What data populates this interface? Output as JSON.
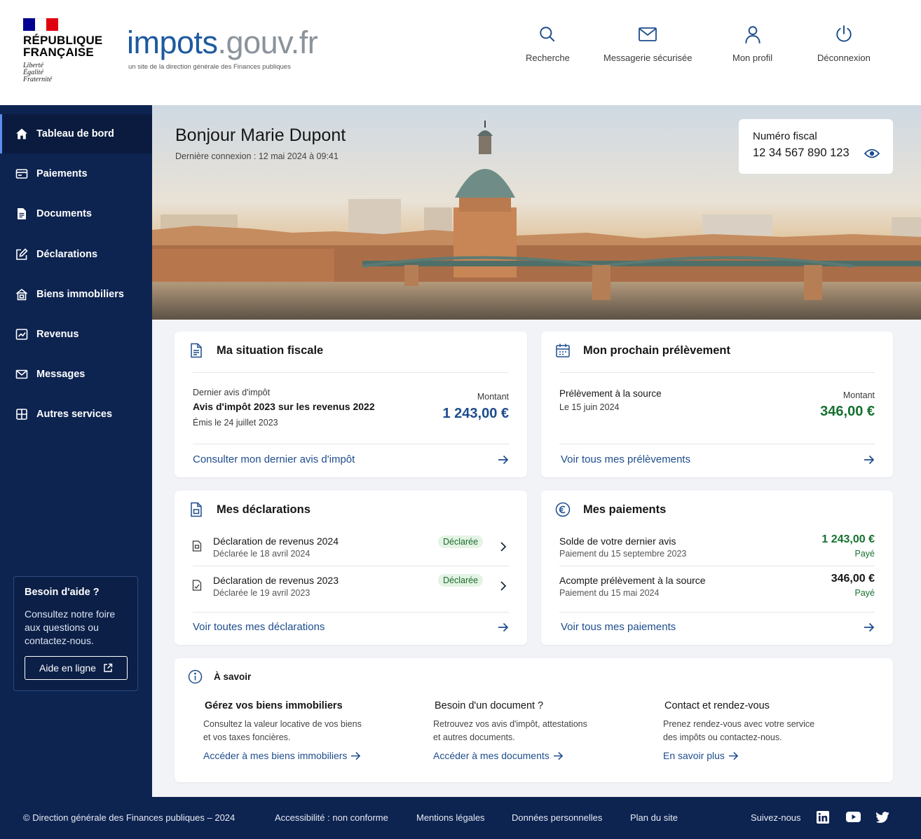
{
  "header": {
    "republic_name": "RÉPUBLIQUE\nFRANÇAISE",
    "motto": "Liberté\nÉgalité\nFraternité",
    "brand_part1": "impots",
    "brand_part2": ".gouv.fr",
    "brand_subtitle": "un site de la direction générale des Finances publiques",
    "nav": [
      {
        "label": "Recherche",
        "icon": "search-icon"
      },
      {
        "label": "Messagerie sécurisée",
        "icon": "mail-icon"
      },
      {
        "label": "Mon profil",
        "icon": "user-icon"
      },
      {
        "label": "Déconnexion",
        "icon": "power-icon"
      }
    ],
    "flag_colors": [
      "#000091",
      "#ffffff",
      "#e1000f"
    ]
  },
  "sidebar": {
    "items": [
      {
        "label": "Tableau de bord",
        "icon": "home-icon"
      },
      {
        "label": "Paiements",
        "icon": "payment-icon"
      },
      {
        "label": "Documents",
        "icon": "document-icon"
      },
      {
        "label": "Déclarations",
        "icon": "edit-icon"
      },
      {
        "label": "Biens immobiliers",
        "icon": "building-icon"
      },
      {
        "label": "Revenus",
        "icon": "income-icon"
      },
      {
        "label": "Messages",
        "icon": "mail-icon"
      },
      {
        "label": "Autres services",
        "icon": "grid-icon"
      }
    ],
    "help": {
      "title": "Besoin d'aide ?",
      "text": "Consultez notre foire aux questions ou contactez-nous.",
      "button": "Aide en ligne"
    }
  },
  "hero": {
    "greeting": "Bonjour Marie Dupont",
    "last_login": "Dernière connexion : 12 mai 2024 à 09:41",
    "fiscal_label": "Numéro fiscal",
    "fiscal_number": "12 34 567 890 123"
  },
  "situation": {
    "title": "Ma situation fiscale",
    "label": "Dernier avis d'impôt",
    "name": "Avis d'impôt 2023 sur les revenus 2022",
    "issued": "Émis le 24 juillet 2023",
    "amount_label": "Montant",
    "amount": "1 243,00 €",
    "link": "Consulter mon dernier avis d'impôt"
  },
  "prelevement": {
    "title": "Mon prochain prélèvement",
    "label": "Prélèvement à la source",
    "date": "Le 15 juin 2024",
    "amount_label": "Montant",
    "amount": "346,00 €",
    "link": "Voir tous mes prélèvements"
  },
  "declarations": {
    "title": "Mes déclarations",
    "rows": [
      {
        "title": "Déclaration de revenus 2024",
        "sub": "Déclarée le 18 avril 2024",
        "status": "Déclarée"
      },
      {
        "title": "Déclaration de revenus 2023",
        "sub": "Déclarée le 19 avril 2023",
        "status": "Déclarée"
      }
    ],
    "link": "Voir toutes mes déclarations"
  },
  "paiements": {
    "title": "Mes paiements",
    "rows": [
      {
        "title": "Solde de votre dernier avis",
        "sub": "Paiement du 15 septembre 2023",
        "amount": "1 243,00 €",
        "status": "Payé"
      },
      {
        "title": "Acompte prélèvement à la source",
        "sub": "Paiement du 15 mai 2024",
        "amount": "346,00 €",
        "status": "Payé"
      }
    ],
    "link": "Voir tous mes paiements"
  },
  "savoir": {
    "title": "À savoir",
    "cols": [
      {
        "title": "Gérez vos biens immobiliers",
        "text": "Consultez la valeur locative de vos biens\net vos taxes foncières.",
        "link": "Accéder à mes biens immobiliers"
      },
      {
        "title": "Besoin d'un document ?",
        "text": "Retrouvez vos avis d'impôt, attestations\net autres documents.",
        "link": "Accéder à mes documents"
      },
      {
        "title": "Contact et rendez-vous",
        "text": "Prenez rendez-vous avec votre service\ndes impôts ou contactez-nous.",
        "link": "En savoir plus"
      }
    ]
  },
  "footer": {
    "copyright": "© Direction générale des Finances publiques – 2024",
    "links": [
      "Accessibilité : non conforme",
      "Mentions légales",
      "Données personnelles",
      "Plan du site"
    ],
    "follow": "Suivez-nous",
    "social": [
      "linkedin-icon",
      "youtube-icon",
      "twitter-icon"
    ]
  },
  "colors": {
    "navy": "#0d2350",
    "link_blue": "#1e4d8c",
    "amount_green": "#16712f",
    "badge_bg": "#e3f3e4"
  }
}
